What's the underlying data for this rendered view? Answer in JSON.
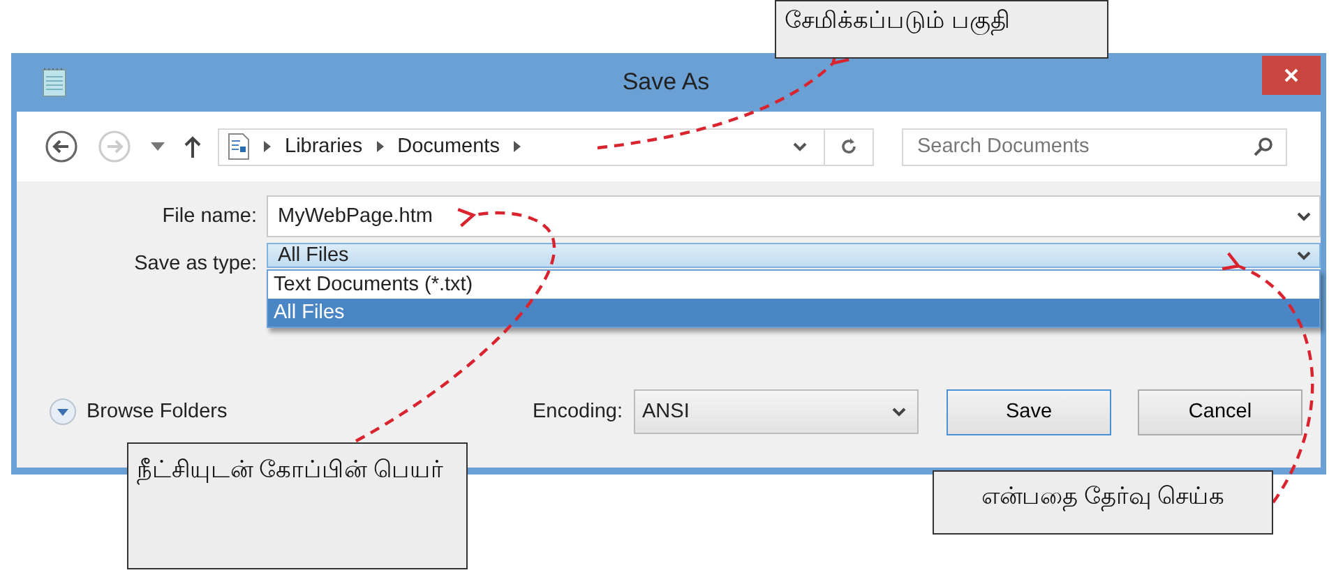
{
  "window": {
    "title": "Save As"
  },
  "nav": {
    "buttons": [
      {
        "kind": "back",
        "disabled": false
      },
      {
        "kind": "forward",
        "disabled": true
      }
    ],
    "breadcrumb": [
      "Libraries",
      "Documents"
    ],
    "search": {
      "placeholder": "Search Documents"
    }
  },
  "form": {
    "file_name": {
      "label": "File name:",
      "value": "MyWebPage.htm"
    },
    "save_as_type": {
      "label": "Save as type:",
      "value": "All Files",
      "expanded": true,
      "options": [
        {
          "label": "Text Documents (*.txt)",
          "selected": false
        },
        {
          "label": "All Files",
          "selected": true
        }
      ]
    }
  },
  "footer": {
    "browse_folders": "Browse Folders",
    "encoding": {
      "label": "Encoding:",
      "value": "ANSI"
    },
    "buttons": [
      {
        "label": "Save",
        "default": true
      },
      {
        "label": "Cancel",
        "default": false
      }
    ]
  },
  "callouts": [
    {
      "text": "சேமிக்கப்படும் பகுதி"
    },
    {
      "text": "நீட்சியுடன் கோப்பின் பெயர்"
    },
    {
      "text": "என்பதை தேர்வு செய்க"
    }
  ]
}
